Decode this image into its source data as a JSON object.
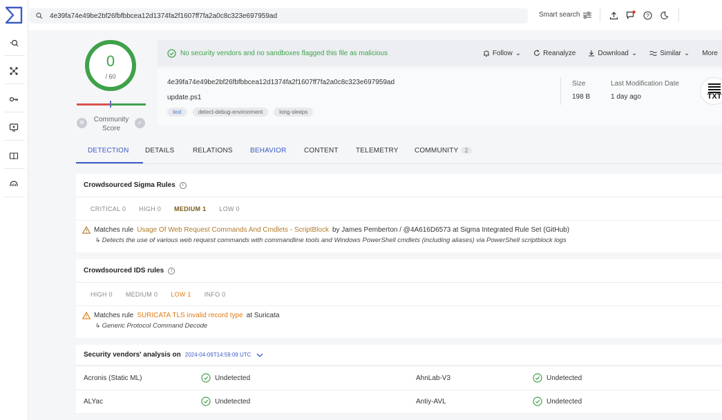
{
  "search": {
    "value": "4e39fa74e49be2bf26fbfbbcea12d1374fa2f1607ff7fa2a0c8c323e697959ad"
  },
  "topbar": {
    "smart_search": "Smart search"
  },
  "score": {
    "detections": "0",
    "total": "/ 60",
    "community_label": "Community Score"
  },
  "banner": {
    "message": "No security vendors and no sandboxes flagged this file as malicious",
    "actions": [
      "Follow",
      "Reanalyze",
      "Download",
      "Similar",
      "More"
    ]
  },
  "file": {
    "hash": "4e39fa74e49be2bf26fbfbbcea12d1374fa2f1607ff7fa2a0c8c323e697959ad",
    "name": "update.ps1",
    "tags": [
      "text",
      "detect-debug-environment",
      "long-sleeps"
    ],
    "size_label": "Size",
    "size_value": "198 B",
    "modified_label": "Last Modification Date",
    "modified_value": "1 day ago",
    "type_icon": "TXT"
  },
  "tabs": [
    "DETECTION",
    "DETAILS",
    "RELATIONS",
    "BEHAVIOR",
    "CONTENT",
    "TELEMETRY",
    "COMMUNITY"
  ],
  "community_count": "2",
  "sigma": {
    "title": "Crowdsourced Sigma Rules",
    "filters": [
      "CRITICAL 0",
      "HIGH 0",
      "MEDIUM 1",
      "LOW 0"
    ],
    "prefix": "Matches rule",
    "rule": "Usage Of Web Request Commands And Cmdlets - ScriptBlock",
    "suffix": "by James Pemberton / @4A616D6573 at Sigma Integrated Rule Set (GitHub)",
    "description": "Detects the use of various web request commands with commandline tools and Windows PowerShell cmdlets (including aliases) via PowerShell scriptblock logs"
  },
  "ids": {
    "title": "Crowdsourced IDS rules",
    "filters": [
      "HIGH 0",
      "MEDIUM 0",
      "LOW 1",
      "INFO 0"
    ],
    "prefix": "Matches rule",
    "rule": "SURICATA TLS invalid record type",
    "suffix": "at Suricata",
    "description": "Generic Protocol Command Decode"
  },
  "vendors": {
    "title": "Security vendors' analysis on",
    "timestamp": "2024-04-09T14:59:09 UTC",
    "rows": [
      {
        "left_name": "Acronis (Static ML)",
        "left_status": "Undetected",
        "right_name": "AhnLab-V3",
        "right_status": "Undetected"
      },
      {
        "left_name": "ALYac",
        "left_status": "Undetected",
        "right_name": "Antiy-AVL",
        "right_status": "Undetected"
      }
    ]
  },
  "colors": {
    "accent": "#3b5bc4",
    "clean": "#3fa14a",
    "warn": "#e07b13"
  }
}
